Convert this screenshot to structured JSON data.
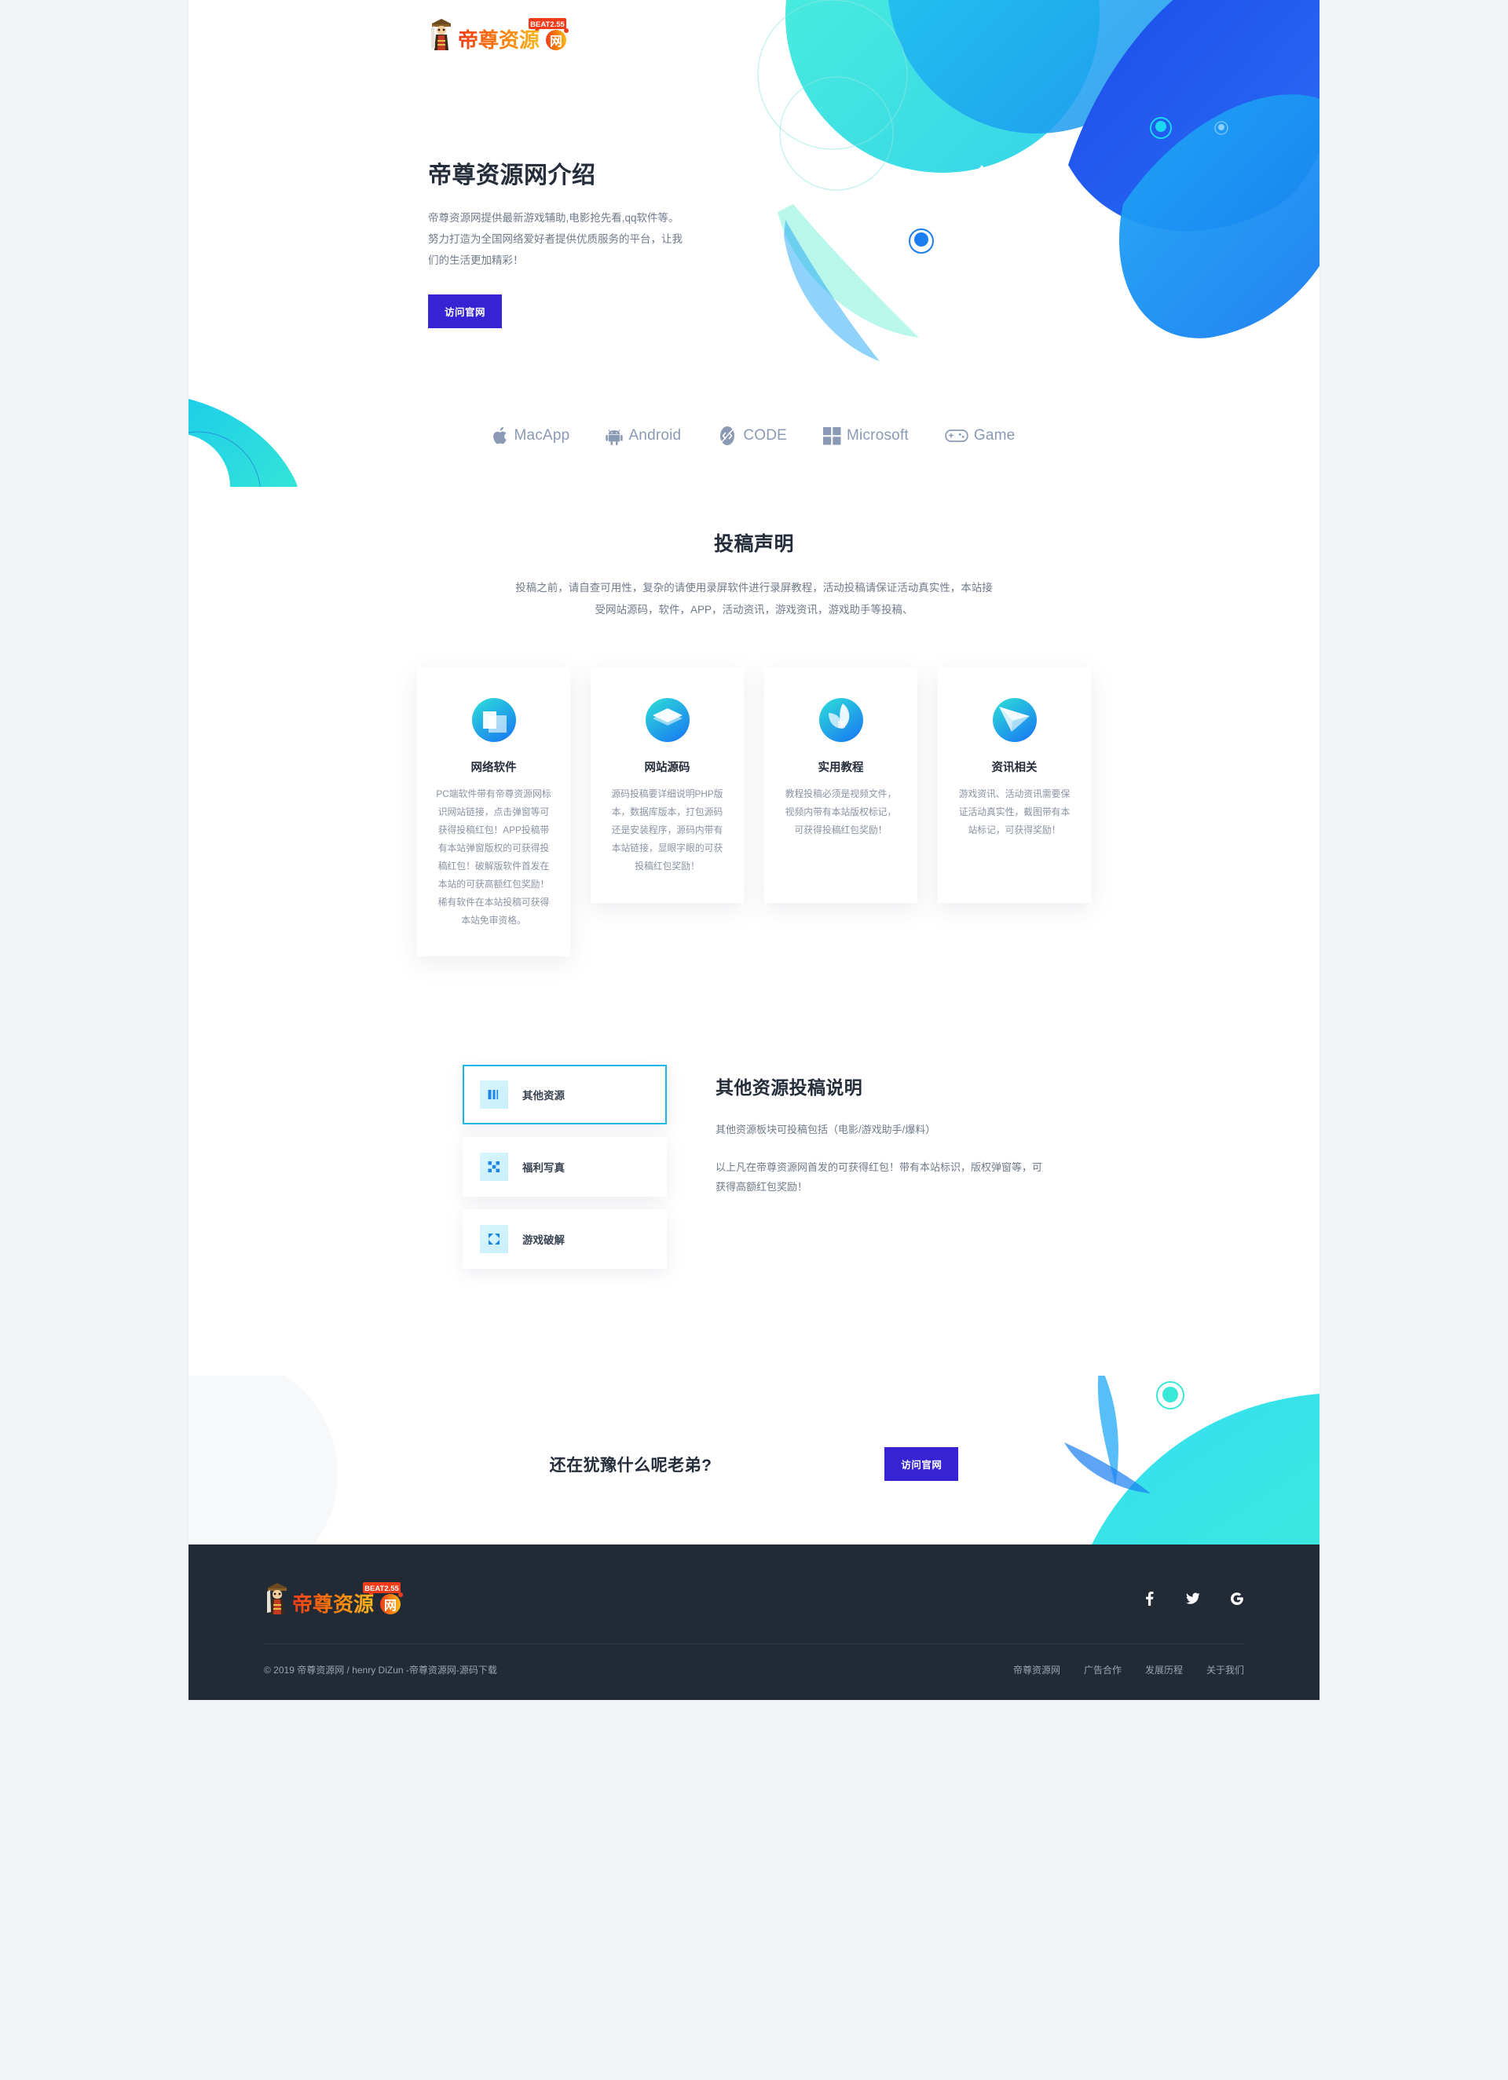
{
  "brand": {
    "logo_text": "帝尊资源网",
    "logo_badge": "BEAT2.55"
  },
  "hero": {
    "title": "帝尊资源网介绍",
    "description": "帝尊资源网提供最新游戏辅助,电影抢先看,qq软件等。努力打造为全国网络爱好者提供优质服务的平台，让我们的生活更加精彩！",
    "cta_label": "访问官网"
  },
  "platforms": [
    {
      "icon": "apple-icon",
      "label": "MacApp"
    },
    {
      "icon": "android-icon",
      "label": "Android"
    },
    {
      "icon": "code-icon",
      "label": "CODE"
    },
    {
      "icon": "microsoft-icon",
      "label": "Microsoft"
    },
    {
      "icon": "gamepad-icon",
      "label": "Game"
    }
  ],
  "declaration": {
    "title": "投稿声明",
    "description": "投稿之前，请自查可用性，复杂的请使用录屏软件进行录屏教程，活动投稿请保证活动真实性，本站接受网站源码，软件，APP，活动资讯，游戏资讯，游戏助手等投稿、"
  },
  "cards": [
    {
      "icon": "window-stack-icon",
      "title": "网络软件",
      "body": "PC端软件带有帝尊资源网标识网站链接，点击弹窗等可获得投稿红包！APP投稿带有本站弹窗版权的可获得投稿红包！破解版软件首发在本站的可获高额红包奖励！稀有软件在本站投稿可获得本站免审资格。"
    },
    {
      "icon": "layers-diamond-icon",
      "title": "网站源码",
      "body": "源码投稿要详细说明PHP版本，数据库版本，打包源码还是安装程序，源码内带有本站链接，显眼字眼的可获投稿红包奖励！"
    },
    {
      "icon": "leaf-drop-icon",
      "title": "实用教程",
      "body": "教程投稿必须是视频文件，视频内带有本站版权标记，可获得投稿红包奖励！"
    },
    {
      "icon": "paper-plane-icon",
      "title": "资讯相关",
      "body": "游戏资讯、活动资讯需要保证活动真实性，截图带有本站标记，可获得奖励！"
    }
  ],
  "tabs": {
    "items": [
      {
        "icon": "bars-icon",
        "label": "其他资源",
        "active": true
      },
      {
        "icon": "scatter-squares-icon",
        "label": "福利写真",
        "active": false
      },
      {
        "icon": "expand-arrows-icon",
        "label": "游戏破解",
        "active": false
      }
    ],
    "content": {
      "title": "其他资源投稿说明",
      "paragraph1": "其他资源板块可投稿包括（电影/游戏助手/爆料）",
      "paragraph2": "以上凡在帝尊资源网首发的可获得红包！带有本站标识，版权弹窗等，可获得高额红包奖励！"
    }
  },
  "cta": {
    "title": "还在犹豫什么呢老弟?",
    "button_label": "访问官网"
  },
  "footer": {
    "copyright": "© 2019 帝尊资源网 / henry DiZun -帝尊资源网-源码下载",
    "socials": [
      {
        "icon": "facebook-icon",
        "name": "facebook"
      },
      {
        "icon": "twitter-icon",
        "name": "twitter"
      },
      {
        "icon": "google-icon",
        "name": "google"
      }
    ],
    "links": [
      "帝尊资源网",
      "广告合作",
      "发展历程",
      "关于我们"
    ]
  },
  "colors": {
    "accent_purple": "#3723d4",
    "accent_cyan": "#16b8ea",
    "dark": "#222a35",
    "text_muted": "#707a89"
  }
}
